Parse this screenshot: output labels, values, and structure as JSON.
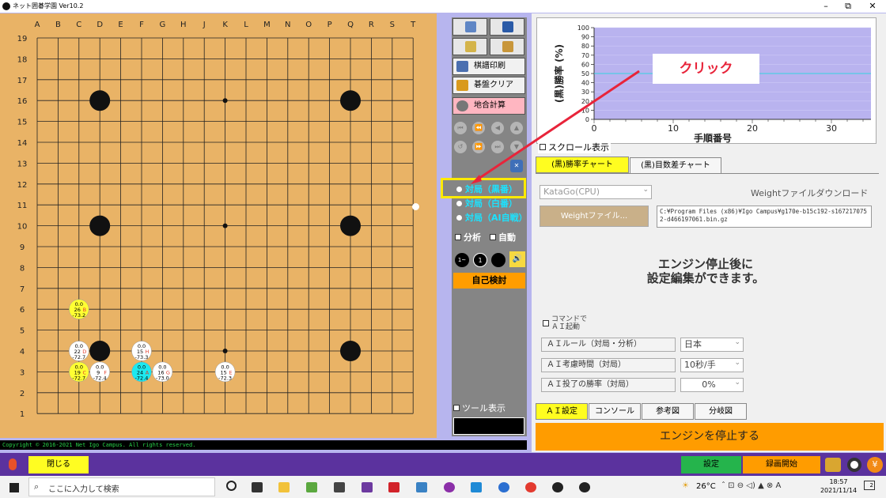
{
  "window": {
    "title": "ネット囲碁学園 Ver10.2",
    "min": "–",
    "max": "⧉",
    "close": "✕"
  },
  "board": {
    "cols": [
      "A",
      "B",
      "C",
      "D",
      "E",
      "F",
      "G",
      "H",
      "J",
      "K",
      "L",
      "M",
      "N",
      "O",
      "P",
      "Q",
      "R",
      "S",
      "T"
    ],
    "rows": [
      "19",
      "18",
      "17",
      "16",
      "15",
      "14",
      "13",
      "12",
      "11",
      "10",
      "9",
      "8",
      "7",
      "6",
      "5",
      "4",
      "3",
      "2",
      "1"
    ],
    "stones": [
      {
        "c": 3,
        "r": 16
      },
      {
        "c": 15,
        "r": 16
      },
      {
        "c": 3,
        "r": 10
      },
      {
        "c": 15,
        "r": 10
      },
      {
        "c": 3,
        "r": 4
      },
      {
        "c": 15,
        "r": 4
      }
    ],
    "hoshi": [
      {
        "c": 9,
        "r": 16
      },
      {
        "c": 9,
        "r": 10
      },
      {
        "c": 9,
        "r": 4
      }
    ],
    "candidates": [
      {
        "c": 2,
        "r": 6,
        "bg": "#ffff33",
        "l1": "0.0",
        "l2": "26",
        "mark": "B",
        "l3": "-73.2"
      },
      {
        "c": 2,
        "r": 4,
        "bg": "#ffffff",
        "l1": "0.0",
        "l2": "22",
        "mark": "D",
        "l3": "-72.7"
      },
      {
        "c": 5,
        "r": 4,
        "bg": "#ffffff",
        "l1": "0.0",
        "l2": "15",
        "mark": "H",
        "l3": "-73.3"
      },
      {
        "c": 2,
        "r": 3,
        "bg": "#ffff33",
        "l1": "0.0",
        "l2": "19",
        "mark": "C",
        "l3": "-72.7"
      },
      {
        "c": 3,
        "r": 3,
        "bg": "#ffffff",
        "l1": "0.0",
        "l2": "9",
        "mark": "F",
        "l3": "-72.4"
      },
      {
        "c": 5,
        "r": 3,
        "bg": "#1de9ef",
        "l1": "0.0",
        "l2": "24",
        "mark": "A",
        "l3": "-72.4"
      },
      {
        "c": 6,
        "r": 3,
        "bg": "#ffffff",
        "l1": "0.0",
        "l2": "16",
        "mark": "G",
        "l3": "-73.0"
      },
      {
        "c": 9,
        "r": 3,
        "bg": "#ffffff",
        "l1": "0.0",
        "l2": "15",
        "mark": "E",
        "l3": "-72.3"
      }
    ]
  },
  "panel": {
    "print": "棋譜印刷",
    "clear": "碁盤クリア",
    "territory": "地合計算",
    "play_black": "対局（黒番）",
    "play_white": "対局（白番）",
    "play_ai": "対局（AI自戦）",
    "analysis": "分析",
    "auto": "自動",
    "review": "自己検討",
    "tools": "ツール表示",
    "stone_icons": [
      "1~",
      "1",
      "●",
      "🔊"
    ]
  },
  "chart": {
    "ylabel": "(黒)勝率 (%)",
    "xlabel": "手順番号",
    "yticks": [
      "100",
      "90",
      "80",
      "70",
      "60",
      "50",
      "40",
      "30",
      "20",
      "10",
      "0"
    ],
    "xticks": [
      "0",
      "10",
      "20",
      "30"
    ],
    "series_value": 50
  },
  "annotation": {
    "label": "クリック"
  },
  "right": {
    "scroll_display": "スクロール表示",
    "tab_winrate": "(黒)勝率チャート",
    "tab_margin": "(黒)目数差チャート",
    "engine_select": "KataGo(CPU)",
    "weight_download": "Weightファイルダウンロード",
    "weight_button": "Weightファイル...",
    "weight_path": "C:¥Program Files (x86)¥Igo Campus¥g170e-b15c192-s1672170752-d466197061.bin.gz",
    "notice_line1": "エンジン停止後に",
    "notice_line2": "設定編集ができます。",
    "cmd_start": "コマンドで\nＡＩ起動",
    "rules": [
      {
        "label": "ＡＩルール（対局・分析）",
        "value": "日本"
      },
      {
        "label": "ＡＩ考慮時間（対局）",
        "value": "10秒/手"
      },
      {
        "label": "ＡＩ投了の勝率（対局）",
        "value": "0%"
      }
    ],
    "bottom_tabs": [
      "ＡＩ設定",
      "コンソール",
      "参考図",
      "分岐図"
    ],
    "stop_engine": "エンジンを停止する"
  },
  "copyright": "Copyright © 2016-2021 Net Igo Campus. All rights reserved.",
  "statusbar": {
    "close": "閉じる",
    "settings": "設定",
    "record": "録画開始"
  },
  "taskbar": {
    "search": "ここに入力して検索",
    "temp": "26°C",
    "time": "18:57",
    "date": "2021/11/14",
    "badge": "2"
  }
}
